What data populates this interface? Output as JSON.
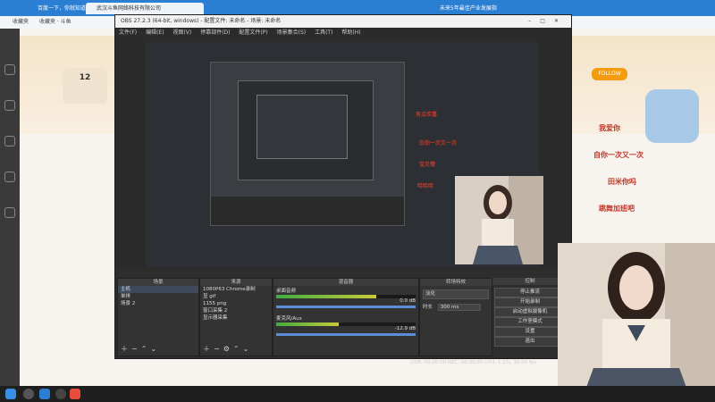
{
  "browser": {
    "tabs": [
      {
        "label": "武汉斗鱼网络科技有限公司",
        "active": true
      },
      {
        "label": "百度一下，你就知道",
        "active": false
      },
      {
        "label": "未来5年最佳产业发展指",
        "active": false
      }
    ],
    "url": "https://www.douyu.com/10075070",
    "bookmarks": [
      "收藏夹",
      "收藏夹 · 斗鱼"
    ]
  },
  "page": {
    "stat_number": "12",
    "badge": "FOLLOW"
  },
  "obs": {
    "title": "OBS 27.2.3 (64-bit, windows) - 配置文件: 未命名 - 场景: 未命名",
    "menu": [
      "文件(F)",
      "编辑(E)",
      "视图(V)",
      "停靠部件(D)",
      "配置文件(P)",
      "场景集合(S)",
      "工具(T)",
      "帮助(H)"
    ],
    "docks": {
      "scenes": {
        "header": "场景",
        "items": [
          "主机",
          "单排",
          "场景 2"
        ]
      },
      "sources": {
        "header": "来源",
        "items": [
          "1080P63 Chrome录制",
          "显 gif",
          "1155 png",
          "窗口采集 2",
          "显示器采集"
        ]
      },
      "mixer": {
        "header": "混音器",
        "channels": [
          {
            "name": "桌面音频",
            "db": "0.0 dB",
            "level": 0.72
          },
          {
            "name": "麦克风/Aux",
            "db": "-12.9 dB",
            "level": 0.45
          }
        ]
      },
      "transitions": {
        "header": "转场特效",
        "type": "淡化",
        "duration_label": "时长",
        "duration": "300 ms"
      },
      "controls": {
        "header": "控制",
        "buttons": [
          "停止推流",
          "开始录制",
          "启动虚拟摄像机",
          "工作室模式",
          "设置",
          "退出"
        ]
      }
    },
    "status": "LIVE: 00:00:00   REC: 00:00:00   CPU: 1.1%, 30.00 fps"
  },
  "stickers": [
    "有点欢喜",
    "白你一次又一次",
    "宝贝情",
    "哈哈哈",
    "我爱你",
    "自你一次又一次",
    "田米你吗",
    "跳舞加班吧"
  ],
  "taskbar": {
    "apps": [
      "start",
      "search",
      "browser",
      "obs",
      "douyu"
    ]
  }
}
